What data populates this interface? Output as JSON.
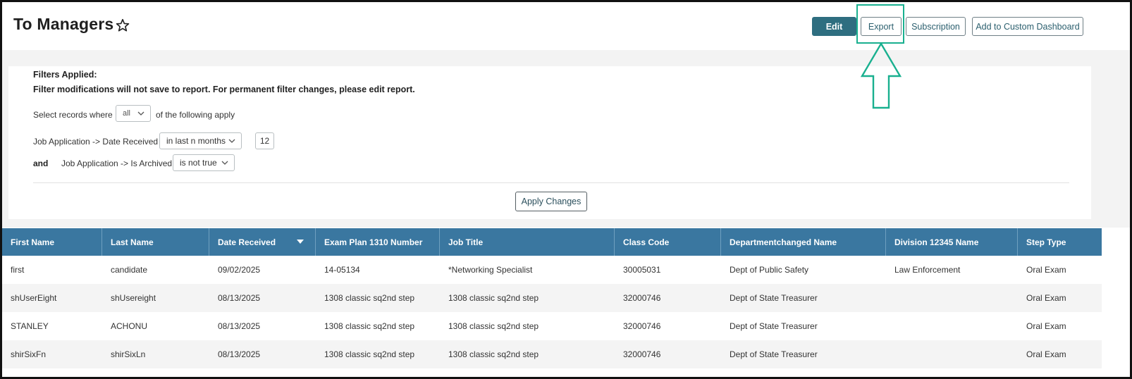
{
  "header": {
    "title": "To Managers",
    "buttons": {
      "edit": "Edit",
      "export": "Export",
      "subscription": "Subscription",
      "add_dashboard": "Add to Custom Dashboard"
    }
  },
  "filters": {
    "heading": "Filters Applied:",
    "note": "Filter modifications will not save to report. For permanent filter changes, please edit report.",
    "select_prefix": "Select records where",
    "match_value": "all",
    "select_suffix": "of the following apply",
    "conditions": [
      {
        "connector": "",
        "field": "Job Application -> Date Received",
        "operator": "in last n months",
        "value": "12"
      },
      {
        "connector": "and",
        "field": "Job Application -> Is Archived",
        "operator": "is not true",
        "value": ""
      }
    ],
    "apply_label": "Apply Changes"
  },
  "table": {
    "columns": [
      "First Name",
      "Last Name",
      "Date Received",
      "Exam Plan 1310 Number",
      "Job Title",
      "Class Code",
      "Departmentchanged Name",
      "Division 12345 Name",
      "Step Type"
    ],
    "rows": [
      [
        "first",
        "candidate",
        "09/02/2025",
        "14-05134",
        "*Networking Specialist",
        "30005031",
        "Dept of Public Safety",
        "Law Enforcement",
        "Oral Exam"
      ],
      [
        "shUserEight",
        "shUsereight",
        "08/13/2025",
        "1308 classic sq2nd step",
        "1308 classic sq2nd step",
        "32000746",
        "Dept of State Treasurer",
        "",
        "Oral Exam"
      ],
      [
        "STANLEY",
        "ACHONU",
        "08/13/2025",
        "1308 classic sq2nd step",
        "1308 classic sq2nd step",
        "32000746",
        "Dept of State Treasurer",
        "",
        "Oral Exam"
      ],
      [
        "shirSixFn",
        "shirSixLn",
        "08/13/2025",
        "1308 classic sq2nd step",
        "1308 classic sq2nd step",
        "32000746",
        "Dept of State Treasurer",
        "",
        "Oral Exam"
      ]
    ]
  },
  "colors": {
    "accent": "#2e6e80",
    "table_header": "#3a77a0",
    "highlight": "#19b08f"
  },
  "icons": {
    "favorite": "star-outline-icon",
    "annotation": "arrow-up-icon",
    "dropdown": "chevron-down-icon",
    "sort": "sort-desc-icon"
  }
}
